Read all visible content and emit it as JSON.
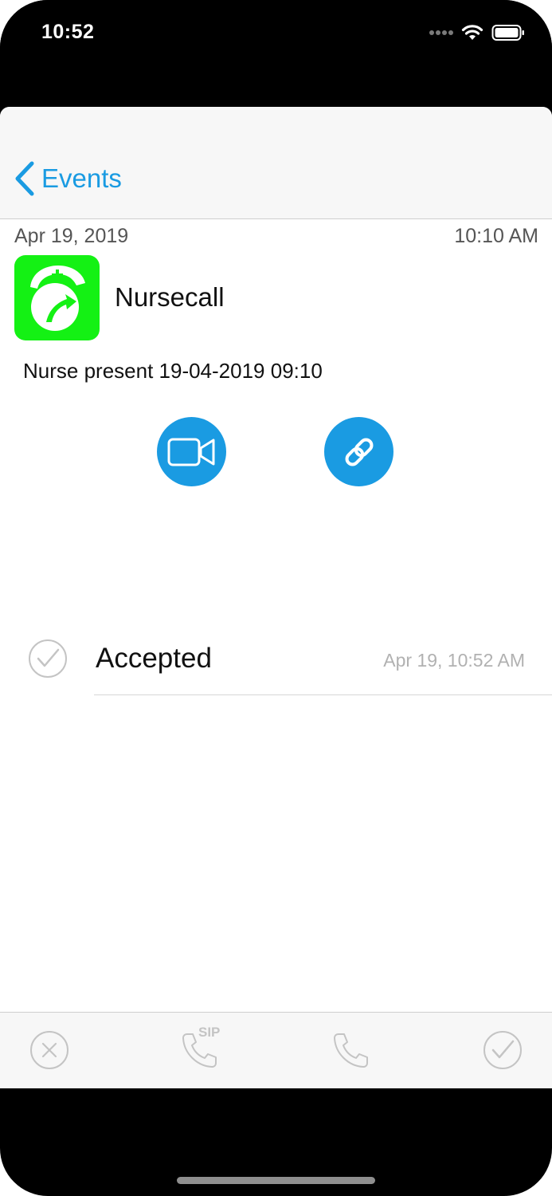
{
  "status": {
    "time": "10:52"
  },
  "nav": {
    "back_label": "Events"
  },
  "event": {
    "date": "Apr 19, 2019",
    "time": "10:10 AM",
    "title": "Nursecall",
    "message": "Nurse present 19-04-2019 09:10",
    "icon_color": "#14f114"
  },
  "actions": [
    {
      "icon": "video-camera-icon"
    },
    {
      "icon": "link-icon"
    }
  ],
  "history": [
    {
      "label": "Accepted",
      "timestamp": "Apr 19, 10:52 AM"
    }
  ],
  "tabbar": {
    "sip_label": "SIP"
  },
  "colors": {
    "accent": "#1a9be2",
    "icon_green": "#14f114"
  }
}
